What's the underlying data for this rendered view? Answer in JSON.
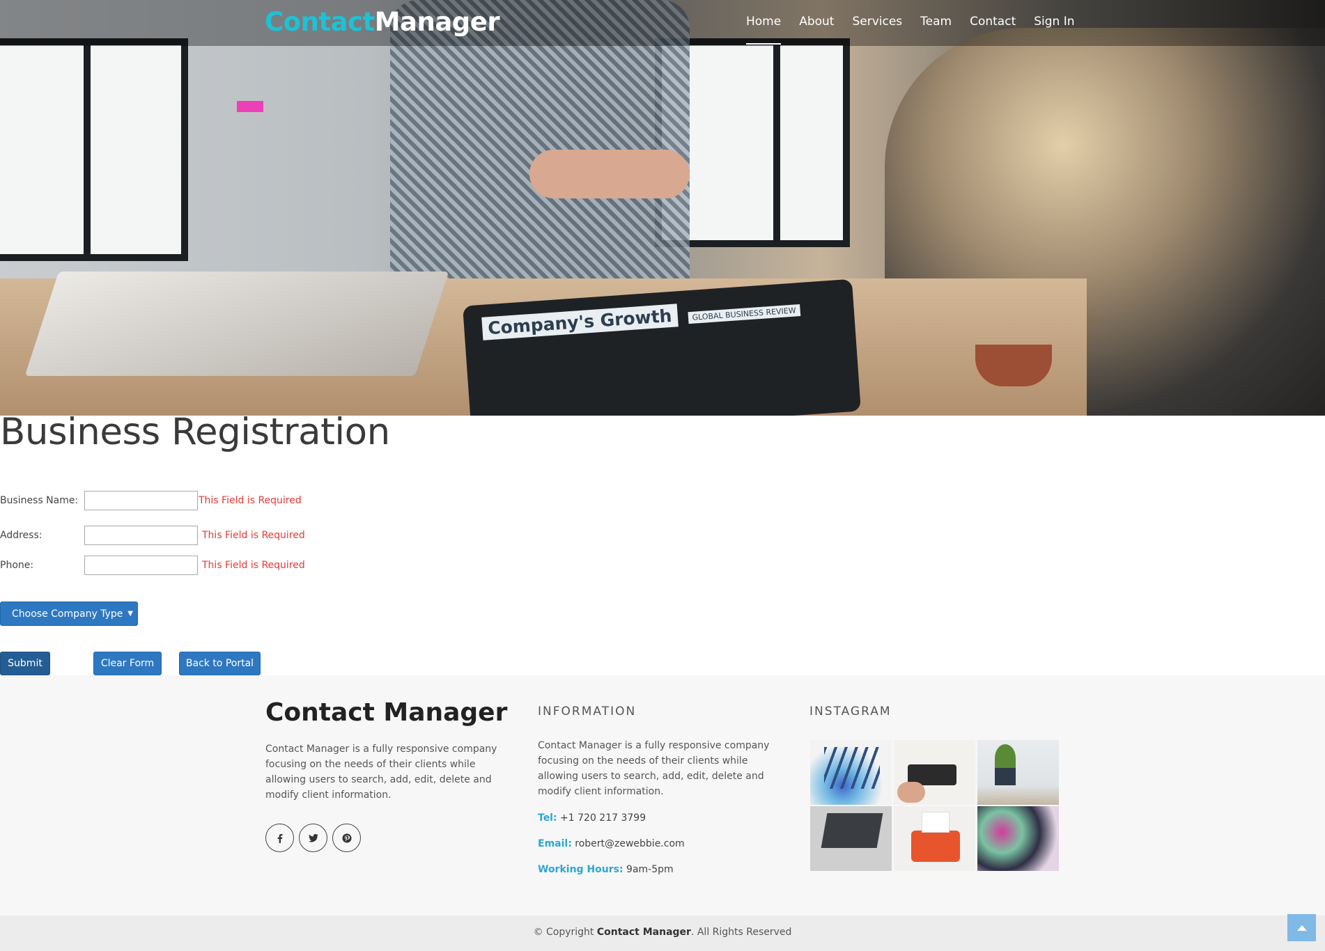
{
  "brand": {
    "part1": "Contact",
    "part2": "Manager",
    "accent": "#1cc2d6"
  },
  "nav": [
    "Home",
    "About",
    "Services",
    "Team",
    "Contact",
    "Sign In"
  ],
  "hero": {
    "screen_title": "Company's Growth",
    "screen_sub": "GLOBAL BUSINESS REVIEW"
  },
  "form": {
    "title": "Business Registration",
    "fields": [
      {
        "label": "Business Name:",
        "error": "This Field is Required"
      },
      {
        "label": "Address:",
        "error": "This Field is Required"
      },
      {
        "label": "Phone:",
        "error": "This Field is Required"
      }
    ],
    "select_label": "Choose Company Type",
    "buttons": {
      "submit": "Submit",
      "clear": "Clear Form",
      "back": "Back to Portal"
    }
  },
  "footer": {
    "brand": "Contact Manager",
    "about": "Contact Manager is a fully responsive company focusing on the needs of their clients while allowing users to search, add, edit, delete and modify client information.",
    "social": [
      "facebook-icon",
      "twitter-icon",
      "pinterest-icon"
    ],
    "info_heading": "INFORMATION",
    "info_text": "Contact Manager is a fully responsive company focusing on the needs of their clients while allowing users to search, add, edit, delete and modify client information.",
    "tel_label": "Tel:",
    "tel": "+1 720 217 3799",
    "email_label": "Email:",
    "email": "robert@zewebbie.com",
    "hours_label": "Working Hours:",
    "hours": "9am-5pm",
    "instagram_heading": "INSTAGRAM",
    "instagram": [
      "watercolor-supplies",
      "keyboard-desk",
      "desk-plant",
      "laptop-desk",
      "orange-typewriter",
      "abstract-paint"
    ]
  },
  "copyright": {
    "prefix": "© Copyright ",
    "brand": "Contact Manager",
    "suffix": ". All Rights Reserved"
  },
  "colors": {
    "button": "#2e78c2",
    "error": "#e53935",
    "label_accent": "#2aa7d1"
  }
}
